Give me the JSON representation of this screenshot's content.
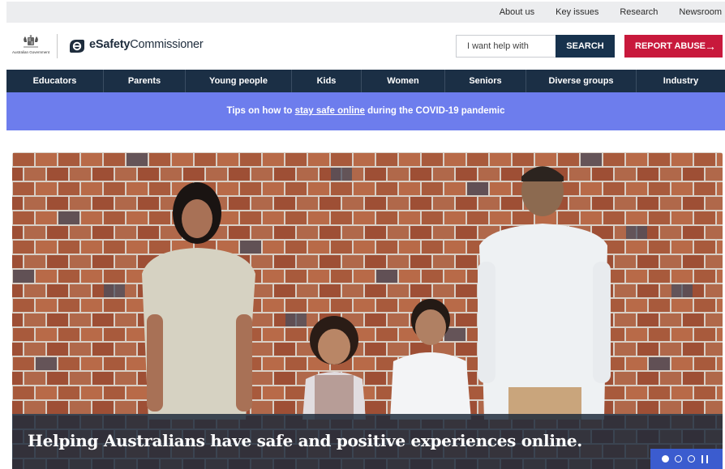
{
  "utility_nav": {
    "items": [
      "About us",
      "Key issues",
      "Research",
      "Newsroom"
    ]
  },
  "header": {
    "gov_logo_text": "Australian Government",
    "brand_bold": "eSafety",
    "brand_regular": "Commissioner",
    "search": {
      "placeholder": "I want help with",
      "button_label": "SEARCH"
    },
    "report_label": "REPORT ABUSE",
    "report_arrow": "→"
  },
  "main_nav": {
    "items": [
      "Educators",
      "Parents",
      "Young people",
      "Kids",
      "Women",
      "Seniors",
      "Diverse groups",
      "Industry"
    ]
  },
  "banner": {
    "prefix": "Tips on how to ",
    "link": "stay safe online",
    "suffix": " during the COVID-19 pandemic"
  },
  "hero": {
    "headline": "Helping Australians have safe and positive experiences online.",
    "slides": {
      "count": 3,
      "active": 1
    }
  },
  "colors": {
    "nav_bg": "#1b2f45",
    "banner_bg": "#6d7ded",
    "report_button": "#c8193c",
    "search_button": "#17324d",
    "slider_control": "#3b5ccf",
    "brick_wall": "#a85a3c"
  }
}
